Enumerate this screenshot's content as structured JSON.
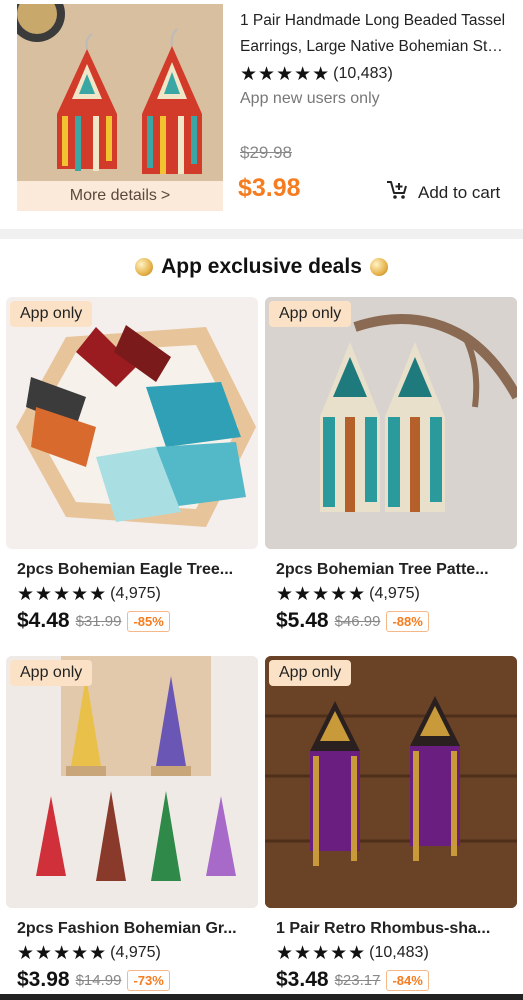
{
  "top_product": {
    "title_line1": "1 Pair Handmade Long Beaded Tassel",
    "title_line2": "Earrings, Large Native Bohemian Styl...",
    "stars": "★★★★★",
    "review_count": "(10,483)",
    "note": "App new users only",
    "original_price": "$29.98",
    "price": "$3.98",
    "more_details": "More details",
    "more_details_chevron": ">",
    "add_to_cart": "Add to cart",
    "cart_icon": "cart-plus-icon"
  },
  "section": {
    "title": "App exclusive deals",
    "left_icon": "coin-icon",
    "right_icon": "coin-icon"
  },
  "products": [
    {
      "badge": "App only",
      "title": "2pcs Bohemian Eagle Tree...",
      "stars": "★★★★★",
      "reviews": "(4,975)",
      "price": "$4.48",
      "original_price": "$31.99",
      "discount": "-85%"
    },
    {
      "badge": "App only",
      "title": "2pcs Bohemian Tree Patte...",
      "stars": "★★★★★",
      "reviews": "(4,975)",
      "price": "$5.48",
      "original_price": "$46.99",
      "discount": "-88%"
    },
    {
      "badge": "App only",
      "title": "2pcs Fashion Bohemian Gr...",
      "stars": "★★★★★",
      "reviews": "(4,975)",
      "price": "$3.98",
      "original_price": "$14.99",
      "discount": "-73%"
    },
    {
      "badge": "App only",
      "title": "1 Pair Retro Rhombus-sha...",
      "stars": "★★★★★",
      "reviews": "(10,483)",
      "price": "$3.48",
      "original_price": "$23.17",
      "discount": "-84%"
    }
  ],
  "colors": {
    "price_orange": "#f57c1f",
    "badge_bg": "#fbe2c6",
    "divider": "#f0f0f0"
  }
}
